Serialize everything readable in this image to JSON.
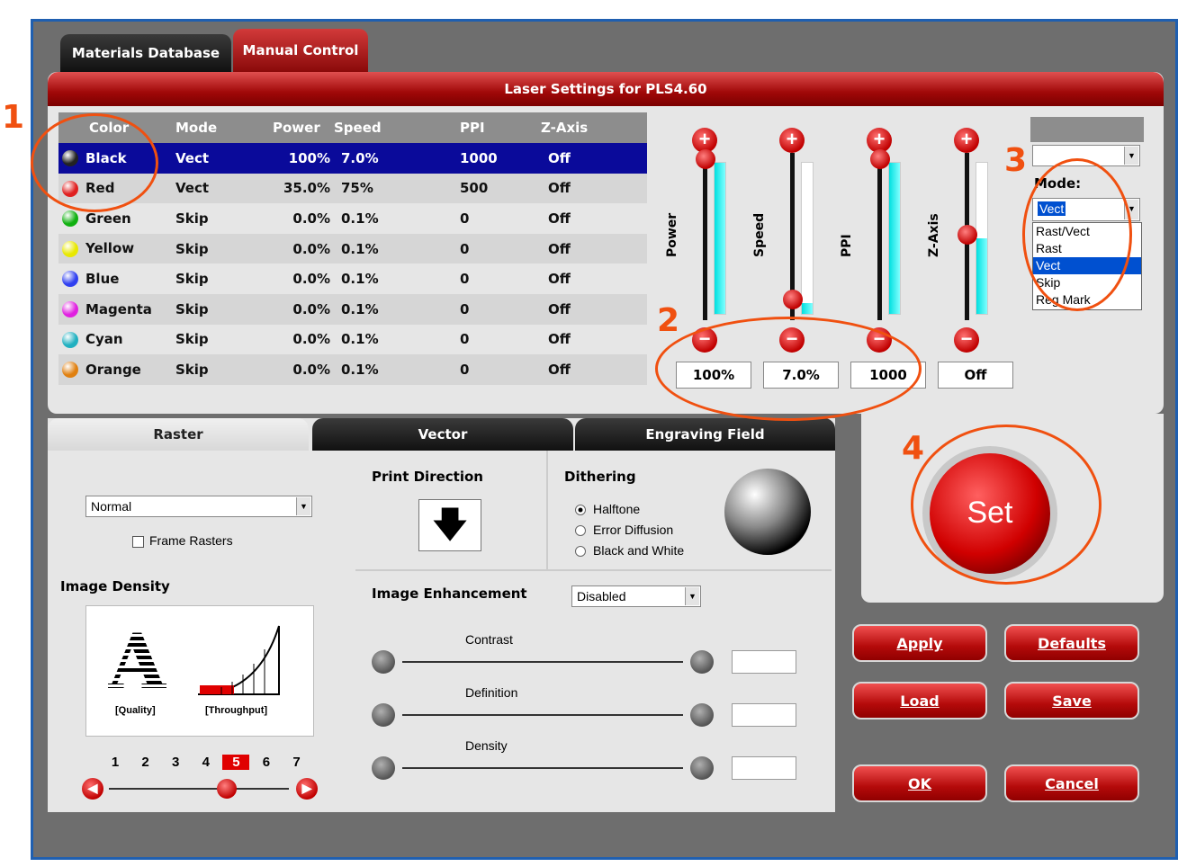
{
  "tabs": {
    "materials": "Materials Database",
    "manual": "Manual Control"
  },
  "header_title": "Laser Settings for PLS4.60",
  "table": {
    "headers": [
      "Color",
      "Mode",
      "Power",
      "Speed",
      "PPI",
      "Z-Axis"
    ],
    "rows": [
      {
        "color": "Black",
        "dot": "#222222",
        "mode": "Vect",
        "power": "100%",
        "speed": "7.0%",
        "ppi": "1000",
        "z": "Off"
      },
      {
        "color": "Red",
        "dot": "#e02020",
        "mode": "Vect",
        "power": "35.0%",
        "speed": "75%",
        "ppi": "500",
        "z": "Off"
      },
      {
        "color": "Green",
        "dot": "#10b010",
        "mode": "Skip",
        "power": "0.0%",
        "speed": "0.1%",
        "ppi": "0",
        "z": "Off"
      },
      {
        "color": "Yellow",
        "dot": "#e8e800",
        "mode": "Skip",
        "power": "0.0%",
        "speed": "0.1%",
        "ppi": "0",
        "z": "Off"
      },
      {
        "color": "Blue",
        "dot": "#3040f0",
        "mode": "Skip",
        "power": "0.0%",
        "speed": "0.1%",
        "ppi": "0",
        "z": "Off"
      },
      {
        "color": "Magenta",
        "dot": "#e020e0",
        "mode": "Skip",
        "power": "0.0%",
        "speed": "0.1%",
        "ppi": "0",
        "z": "Off"
      },
      {
        "color": "Cyan",
        "dot": "#20b0c0",
        "mode": "Skip",
        "power": "0.0%",
        "speed": "0.1%",
        "ppi": "0",
        "z": "Off"
      },
      {
        "color": "Orange",
        "dot": "#e08010",
        "mode": "Skip",
        "power": "0.0%",
        "speed": "0.1%",
        "ppi": "0",
        "z": "Off"
      }
    ]
  },
  "sliders": [
    {
      "label": "Power",
      "value": "100%",
      "level": 1.0
    },
    {
      "label": "Speed",
      "value": "7.0%",
      "level": 0.07
    },
    {
      "label": "PPI",
      "value": "1000",
      "level": 1.0
    },
    {
      "label": "Z-Axis",
      "value": "Off",
      "level": 0.5
    }
  ],
  "mode_panel": {
    "label": "Mode:",
    "selected": "Vect",
    "options": [
      "Rast/Vect",
      "Rast",
      "Vect",
      "Skip",
      "Reg Mark"
    ]
  },
  "set_label": "Set",
  "annotations": [
    "1",
    "2",
    "3",
    "4"
  ],
  "bottom_tabs": {
    "raster": "Raster",
    "vector": "Vector",
    "engraving": "Engraving Field"
  },
  "raster": {
    "quality_select": "Normal",
    "frame_rasters": "Frame Rasters",
    "image_density": "Image Density",
    "quality_caption": "[Quality]",
    "throughput_caption": "[Throughput]",
    "density_steps": [
      "1",
      "2",
      "3",
      "4",
      "5",
      "6",
      "7"
    ],
    "density_selected": "5"
  },
  "print_direction": "Print Direction",
  "dithering": {
    "title": "Dithering",
    "options": [
      "Halftone",
      "Error Diffusion",
      "Black and White"
    ],
    "selected": "Halftone"
  },
  "image_enhancement": {
    "title": "Image Enhancement",
    "value": "Disabled",
    "sliders": [
      "Contrast",
      "Definition",
      "Density"
    ]
  },
  "buttons": {
    "apply": "Apply",
    "defaults": "Defaults",
    "load": "Load",
    "save": "Save",
    "ok": "OK",
    "cancel": "Cancel"
  },
  "colors": {
    "accent_red": "#c00000",
    "selection_blue": "#0a0a9a",
    "panel_grey": "#e6e6e6",
    "annotation_orange": "#f05010"
  }
}
